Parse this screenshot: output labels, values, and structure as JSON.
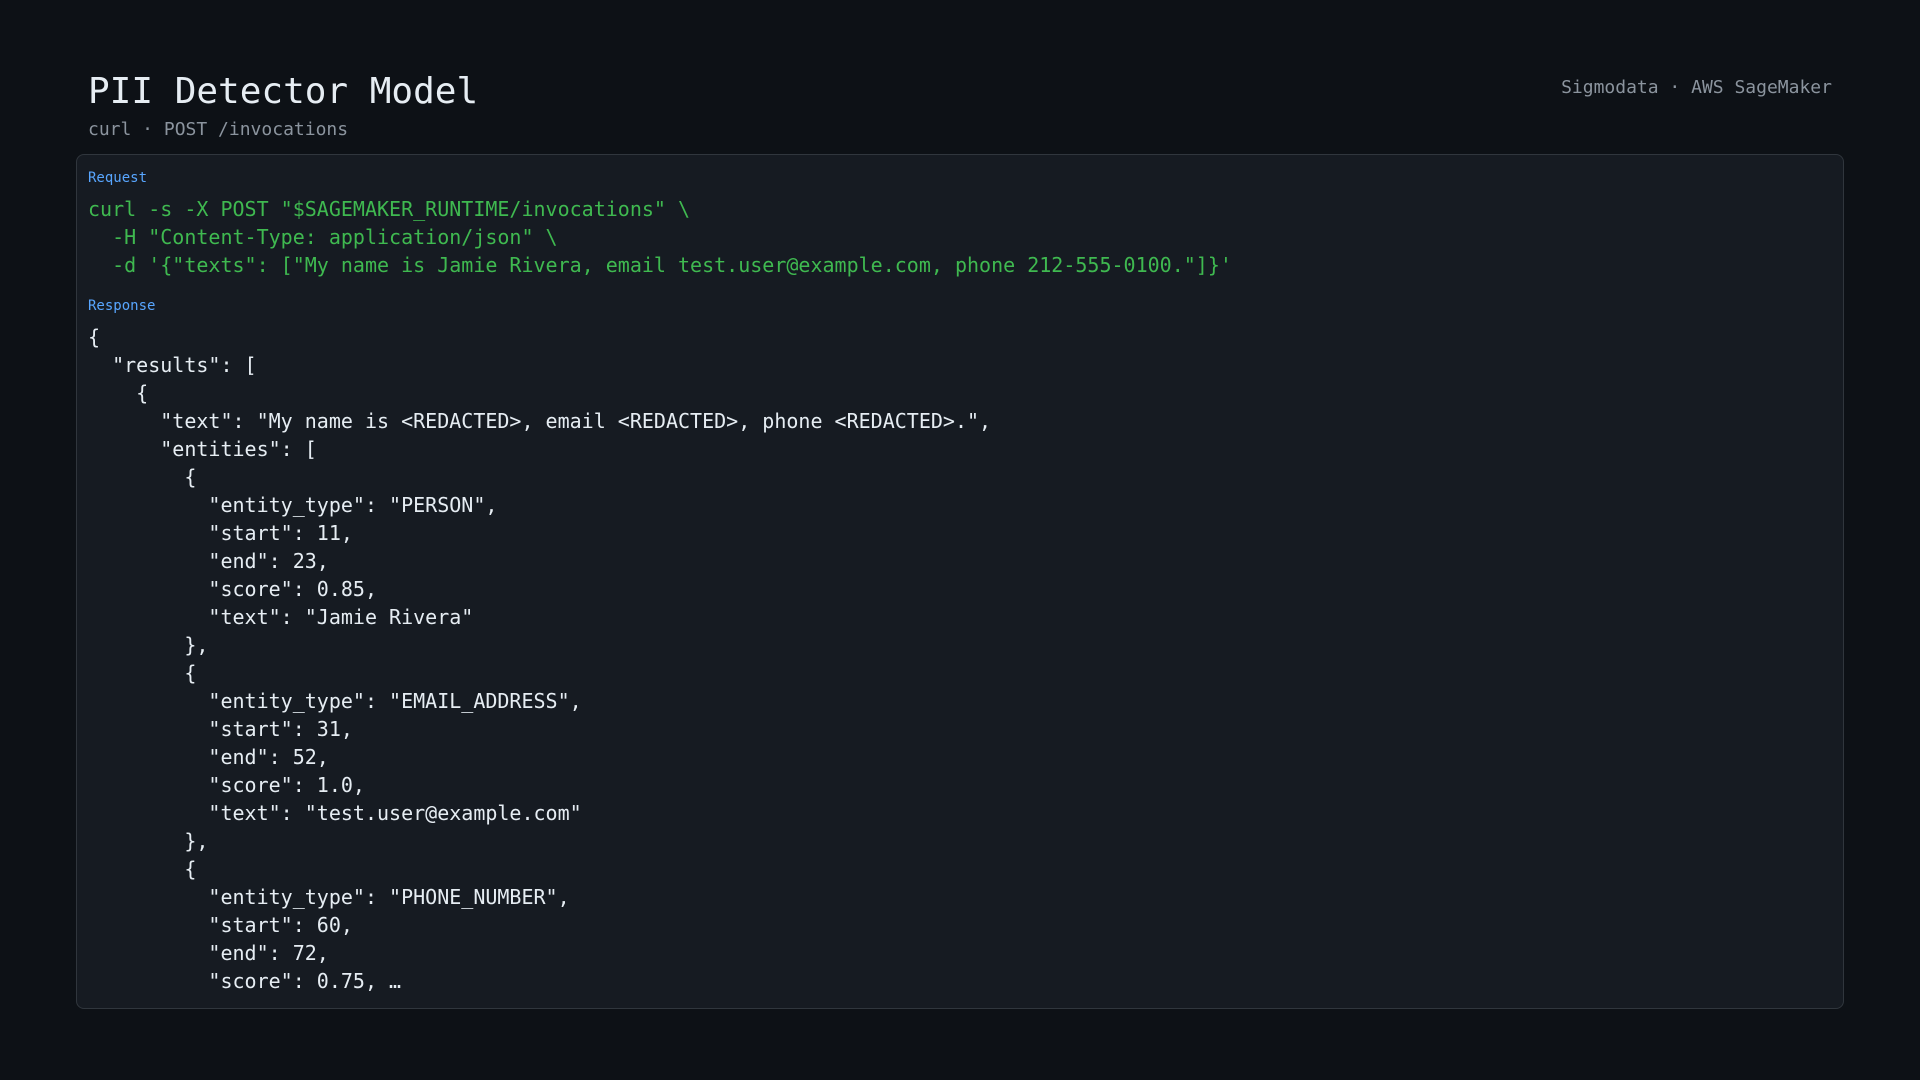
{
  "header": {
    "title": "PII Detector Model",
    "subtitle": "curl · POST /invocations",
    "brand": "Sigmodata · AWS SageMaker"
  },
  "request": {
    "label": "Request",
    "lines": [
      "curl -s -X POST \"$SAGEMAKER_RUNTIME/invocations\" \\",
      "  -H \"Content-Type: application/json\" \\",
      "  -d '{\"texts\": [\"My name is Jamie Rivera, email test.user@example.com, phone 212-555-0100.\"]}'"
    ]
  },
  "response": {
    "label": "Response",
    "lines": [
      "{",
      "  \"results\": [",
      "    {",
      "      \"text\": \"My name is <REDACTED>, email <REDACTED>, phone <REDACTED>.\",",
      "      \"entities\": [",
      "        {",
      "          \"entity_type\": \"PERSON\",",
      "          \"start\": 11,",
      "          \"end\": 23,",
      "          \"score\": 0.85,",
      "          \"text\": \"Jamie Rivera\"",
      "        },",
      "        {",
      "          \"entity_type\": \"EMAIL_ADDRESS\",",
      "          \"start\": 31,",
      "          \"end\": 52,",
      "          \"score\": 1.0,",
      "          \"text\": \"test.user@example.com\"",
      "        },",
      "        {",
      "          \"entity_type\": \"PHONE_NUMBER\",",
      "          \"start\": 60,",
      "          \"end\": 72,",
      "          \"score\": 0.75, …"
    ]
  }
}
